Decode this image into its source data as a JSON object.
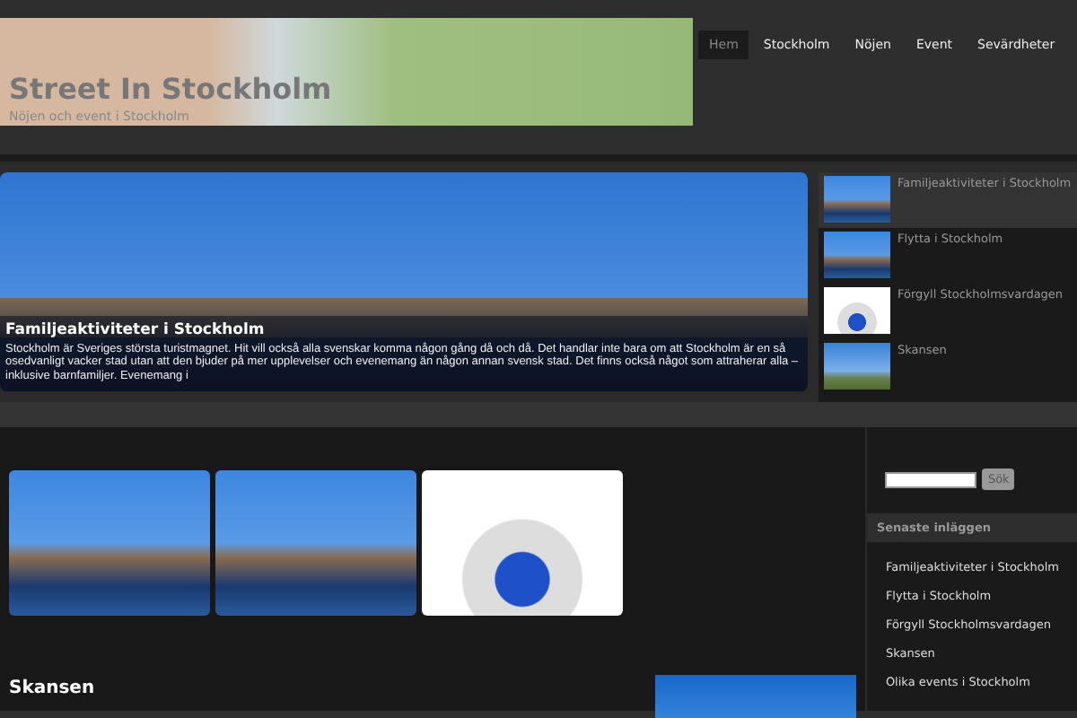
{
  "header": {
    "title": "Street In Stockholm",
    "tagline": "Nöjen och event i Stockholm"
  },
  "nav": [
    {
      "label": "Hem",
      "selected": true
    },
    {
      "label": "Stockholm",
      "selected": false
    },
    {
      "label": "Nöjen",
      "selected": false
    },
    {
      "label": "Event",
      "selected": false
    },
    {
      "label": "Sevärdheter",
      "selected": false
    }
  ],
  "slider": {
    "title": "Familjeaktiviteter i Stockholm",
    "text": "Stockholm är Sveriges största turistmagnet. Hit vill också alla svenskar komma någon gång då och då. Det handlar inte bara om att Stockholm är en så osedvanligt vacker stad utan att den bjuder på mer upplevelser och evenemang än någon annan svensk stad. Det finns också något som attraherar alla – inklusive barnfamiljer. Evenemang i",
    "items": [
      {
        "label": "Familjeaktiviteter i Stockholm",
        "selected": true,
        "kind": "city"
      },
      {
        "label": "Flytta i Stockholm",
        "selected": false,
        "kind": "city"
      },
      {
        "label": "Förgyll Stockholmsvardagen",
        "selected": false,
        "kind": "sign"
      },
      {
        "label": "Skansen",
        "selected": false,
        "kind": "mill"
      }
    ]
  },
  "gallery": [
    {
      "kind": "city"
    },
    {
      "kind": "city"
    },
    {
      "kind": "sign"
    }
  ],
  "post": {
    "title": "Skansen"
  },
  "sidebar": {
    "search_button": "Sök",
    "recent_heading": "Senaste inläggen",
    "recent": [
      "Familjeaktiviteter i Stockholm",
      "Flytta i Stockholm",
      "Förgyll Stockholmsvardagen",
      "Skansen",
      "Olika events i Stockholm"
    ]
  }
}
